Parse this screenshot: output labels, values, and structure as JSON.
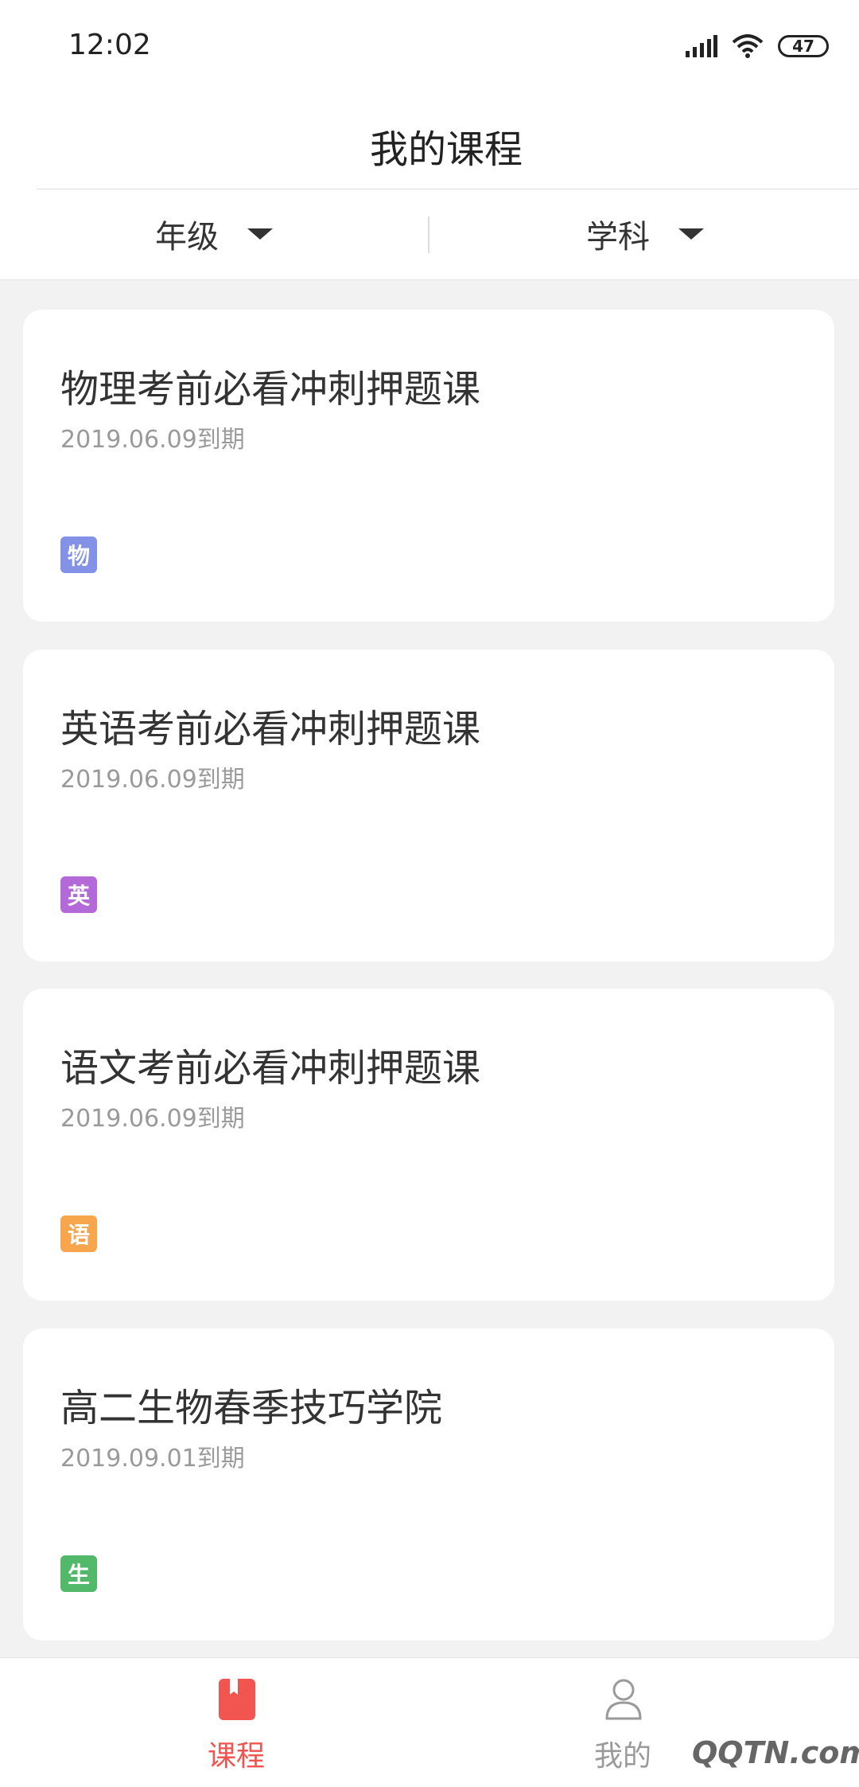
{
  "status_bar": {
    "time": "12:02",
    "battery": "47"
  },
  "header": {
    "title": "我的课程"
  },
  "filters": {
    "grade": "年级",
    "subject": "学科"
  },
  "courses": [
    {
      "title": "物理考前必看冲刺押题课",
      "expiry": "2019.06.09到期",
      "tag": "物",
      "tag_color": "#8392e6"
    },
    {
      "title": "英语考前必看冲刺押题课",
      "expiry": "2019.06.09到期",
      "tag": "英",
      "tag_color": "#b469d9"
    },
    {
      "title": "语文考前必看冲刺押题课",
      "expiry": "2019.06.09到期",
      "tag": "语",
      "tag_color": "#f7a64e"
    },
    {
      "title": "高二生物春季技巧学院",
      "expiry": "2019.09.01到期",
      "tag": "生",
      "tag_color": "#52b86a"
    }
  ],
  "tabs": {
    "courses": "课程",
    "mine": "我的"
  },
  "colors": {
    "accent": "#f2544f",
    "inactive": "#9a9a9a"
  },
  "watermark": "QQTN.com"
}
